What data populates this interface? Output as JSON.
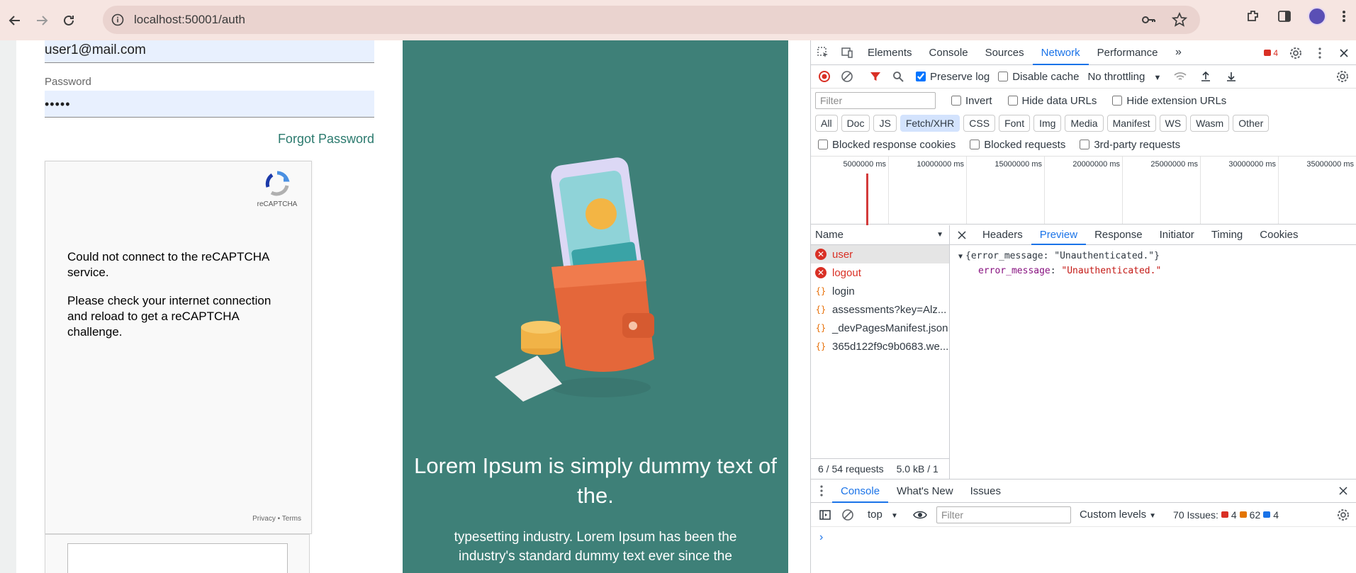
{
  "browser": {
    "url": "localhost:50001/auth"
  },
  "form": {
    "email_value": "user1@mail.com",
    "password_label": "Password",
    "password_value": "•••••",
    "forgot_label": "Forgot Password",
    "captcha": {
      "brand": "reCAPTCHA",
      "error_line1": "Could not connect to the reCAPTCHA service.",
      "error_line2": "Please check your internet connection and reload to get a reCAPTCHA challenge.",
      "privacy": "Privacy",
      "terms": "Terms"
    }
  },
  "hero": {
    "title": "Lorem Ipsum is simply dummy text of the.",
    "subtitle": "typesetting industry. Lorem Ipsum has been the industry's standard dummy text ever since the"
  },
  "devtools": {
    "tabs": [
      "Elements",
      "Console",
      "Sources",
      "Network",
      "Performance"
    ],
    "active_tab": "Network",
    "error_count": "4",
    "toolbar": {
      "preserve_log": "Preserve log",
      "disable_cache": "Disable cache",
      "throttling": "No throttling"
    },
    "filter": {
      "placeholder": "Filter",
      "invert": "Invert",
      "hide_data_urls": "Hide data URLs",
      "hide_ext_urls": "Hide extension URLs"
    },
    "types": [
      "All",
      "Doc",
      "JS",
      "Fetch/XHR",
      "CSS",
      "Font",
      "Img",
      "Media",
      "Manifest",
      "WS",
      "Wasm",
      "Other"
    ],
    "active_type": "Fetch/XHR",
    "blocked": {
      "cookies": "Blocked response cookies",
      "requests": "Blocked requests",
      "third_party": "3rd-party requests"
    },
    "timeline_ticks": [
      "5000000 ms",
      "10000000 ms",
      "15000000 ms",
      "20000000 ms",
      "25000000 ms",
      "30000000 ms",
      "35000000 ms"
    ],
    "name_header": "Name",
    "requests": [
      {
        "name": "user",
        "status": "error"
      },
      {
        "name": "logout",
        "status": "error"
      },
      {
        "name": "login",
        "status": "xhr"
      },
      {
        "name": "assessments?key=Alz...",
        "status": "xhr"
      },
      {
        "name": "_devPagesManifest.json",
        "status": "xhr"
      },
      {
        "name": "365d122f9c9b0683.we...",
        "status": "xhr"
      }
    ],
    "status_requests": "6 / 54 requests",
    "status_size": "5.0 kB / 1",
    "detail_tabs": [
      "Headers",
      "Preview",
      "Response",
      "Initiator",
      "Timing",
      "Cookies"
    ],
    "active_detail_tab": "Preview",
    "preview": {
      "summary": "{error_message: \"Unauthenticated.\"}",
      "key": "error_message",
      "value": "\"Unauthenticated.\""
    },
    "drawer_tabs": [
      "Console",
      "What's New",
      "Issues"
    ],
    "console": {
      "context": "top",
      "filter_placeholder": "Filter",
      "levels": "Custom levels",
      "issues_label": "70 Issues:",
      "issues_red": "4",
      "issues_orange": "62",
      "issues_blue": "4"
    }
  },
  "colors": {
    "teal": "#3e8078",
    "link": "#2b7a6e",
    "devtools_accent": "#1a73e8",
    "error": "#d93025"
  }
}
